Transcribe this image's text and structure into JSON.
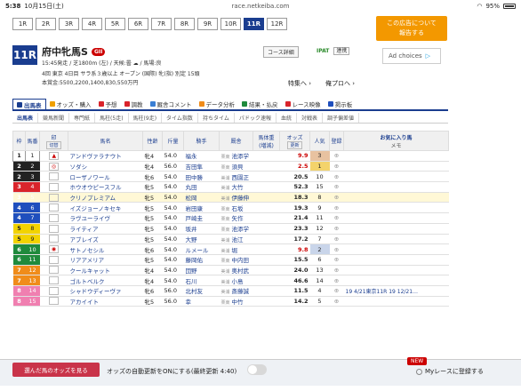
{
  "status": {
    "time": "5:38",
    "date": "10月15日(土)",
    "url": "race.netkeiba.com",
    "battery": "95%"
  },
  "race_tabs": [
    "1R",
    "2R",
    "3R",
    "4R",
    "5R",
    "6R",
    "7R",
    "8R",
    "9R",
    "10R",
    "11R",
    "12R"
  ],
  "active_tab": 10,
  "ad": {
    "text1": "この広告について",
    "text2": "報告する",
    "adchoices": "Ad choices"
  },
  "race": {
    "number": "11R",
    "name": "府中牝馬S",
    "grade": "GII",
    "line1": "15:45発走 / 芝1800m (左) / 天候:曇 ☁ / 馬場:良",
    "line2": "4回 東京 4日目  サラ系３歳以上  オープン       (国際) 牝(指) 別定  15頭",
    "line3": "本賞金:5500,2200,1400,830,550万円",
    "course_btn": "コース詳細",
    "ipat": "IPAT",
    "ipat_sub": "連携",
    "feature": "特集へ ›",
    "prevnext": "俺プロへ ›"
  },
  "main_nav": [
    {
      "label": "出馬表",
      "color": "#1a3d8f"
    },
    {
      "label": "オッズ・購入",
      "color": "#f0a000"
    },
    {
      "label": "予想",
      "color": "#d9242b"
    },
    {
      "label": "調教",
      "color": "#d9242b"
    },
    {
      "label": "厩舎コメント",
      "color": "#3a7fd4"
    },
    {
      "label": "データ分析",
      "color": "#f08c1a"
    },
    {
      "label": "結果・払戻",
      "color": "#1f8a3c"
    },
    {
      "label": "レース映像",
      "color": "#d9242b"
    },
    {
      "label": "掲示板",
      "color": "#1f4fbd"
    }
  ],
  "sub_nav": [
    "出馬表",
    "競馬新聞",
    "専門紙",
    "馬柱(5走)",
    "馬柱(9走)",
    "タイム指数",
    "持ちタイム",
    "パドック速報",
    "血統",
    "対戦表",
    "調子偏差値"
  ],
  "headers": {
    "waku": "枠",
    "umaban": "馬番",
    "mark": "印",
    "mark_sub": "切替",
    "name": "馬名",
    "sexage": "性齢",
    "weight": "斤量",
    "jockey": "騎手",
    "stable": "厩舎",
    "bodyweight": "馬体重",
    "bodyweight_sub": "(増減)",
    "odds": "オッズ",
    "odds_sub": "更新",
    "ninki": "人気",
    "reg": "登録",
    "fav": "お気に入り馬",
    "memo": "メモ"
  },
  "entries": [
    {
      "waku": "1",
      "num": "1",
      "mark": "▲",
      "name": "アンドヴァラナウト",
      "sa": "牝4",
      "kg": "54.0",
      "jockey": "福永",
      "loc": "栗東",
      "stable": "池添学",
      "odds": "9.9",
      "ninki": "3",
      "memo": ""
    },
    {
      "waku": "2",
      "num": "2",
      "mark": "◎",
      "name": "ソダシ",
      "sa": "牝4",
      "kg": "56.0",
      "jockey": "吉田隼",
      "loc": "栗東",
      "stable": "須貝",
      "odds": "2.5",
      "ninki": "1",
      "memo": ""
    },
    {
      "waku": "2",
      "num": "3",
      "mark": "",
      "name": "ローザノワール",
      "sa": "牝6",
      "kg": "54.0",
      "jockey": "田中勝",
      "loc": "美浦",
      "stable": "西園正",
      "odds": "20.5",
      "ninki": "10",
      "memo": ""
    },
    {
      "waku": "3",
      "num": "4",
      "mark": "",
      "name": "ホウオウピースフル",
      "sa": "牝5",
      "kg": "54.0",
      "jockey": "丸田",
      "loc": "美浦",
      "stable": "大竹",
      "odds": "52.3",
      "ninki": "15",
      "memo": ""
    },
    {
      "waku": "3",
      "num": "5",
      "mark": "",
      "name": "クリノプレミアム",
      "sa": "牝5",
      "kg": "54.0",
      "jockey": "松岡",
      "loc": "美浦",
      "stable": "伊藤伸",
      "odds": "18.3",
      "ninki": "8",
      "memo": ""
    },
    {
      "waku": "4",
      "num": "6",
      "mark": "",
      "name": "イズジョーノキセキ",
      "sa": "牝5",
      "kg": "54.0",
      "jockey": "岩田康",
      "loc": "栗東",
      "stable": "石坂",
      "odds": "19.3",
      "ninki": "9",
      "memo": ""
    },
    {
      "waku": "4",
      "num": "7",
      "mark": "",
      "name": "ラヴユーライヴ",
      "sa": "牝5",
      "kg": "54.0",
      "jockey": "戸崎圭",
      "loc": "栗東",
      "stable": "矢作",
      "odds": "21.4",
      "ninki": "11",
      "memo": ""
    },
    {
      "waku": "5",
      "num": "8",
      "mark": "",
      "name": "ライティア",
      "sa": "牝5",
      "kg": "54.0",
      "jockey": "坂井",
      "loc": "栗東",
      "stable": "池添学",
      "odds": "23.3",
      "ninki": "12",
      "memo": ""
    },
    {
      "waku": "5",
      "num": "9",
      "mark": "",
      "name": "アブレイズ",
      "sa": "牝5",
      "kg": "54.0",
      "jockey": "大野",
      "loc": "美浦",
      "stable": "池江",
      "odds": "17.2",
      "ninki": "7",
      "memo": ""
    },
    {
      "waku": "6",
      "num": "10",
      "mark": "◉",
      "name": "サトノセシル",
      "sa": "牝6",
      "kg": "54.0",
      "jockey": "ルメール",
      "loc": "美浦",
      "stable": "堀",
      "odds": "9.8",
      "ninki": "2",
      "memo": ""
    },
    {
      "waku": "6",
      "num": "11",
      "mark": "",
      "name": "リアアメリア",
      "sa": "牝5",
      "kg": "54.0",
      "jockey": "藤岡佑",
      "loc": "栗東",
      "stable": "中内田",
      "odds": "15.5",
      "ninki": "6",
      "memo": ""
    },
    {
      "waku": "7",
      "num": "12",
      "mark": "",
      "name": "クールキャット",
      "sa": "牝4",
      "kg": "54.0",
      "jockey": "団野",
      "loc": "美浦",
      "stable": "奥村武",
      "odds": "24.0",
      "ninki": "13",
      "memo": ""
    },
    {
      "waku": "7",
      "num": "13",
      "mark": "",
      "name": "ゴルトベルク",
      "sa": "牝4",
      "kg": "54.0",
      "jockey": "石川",
      "loc": "美浦",
      "stable": "小島",
      "odds": "46.6",
      "ninki": "14",
      "memo": ""
    },
    {
      "waku": "8",
      "num": "14",
      "mark": "",
      "name": "シャドウディーヴァ",
      "sa": "牝6",
      "kg": "56.0",
      "jockey": "北村友",
      "loc": "美浦",
      "stable": "斎藤誠",
      "odds": "11.5",
      "ninki": "4",
      "memo": "19 4/21東京11R 19 12/21…"
    },
    {
      "waku": "8",
      "num": "15",
      "mark": "",
      "name": "アカイイト",
      "sa": "牝5",
      "kg": "56.0",
      "jockey": "幸",
      "loc": "栗東",
      "stable": "中竹",
      "odds": "14.2",
      "ninki": "5",
      "memo": ""
    }
  ],
  "bottom": {
    "odds_btn": "選んだ馬のオッズを見る",
    "auto_text": "オッズの自動更新をONにする(最終更新 4:40)",
    "new_badge": "NEW",
    "myrace": "Myレースに登録する"
  }
}
